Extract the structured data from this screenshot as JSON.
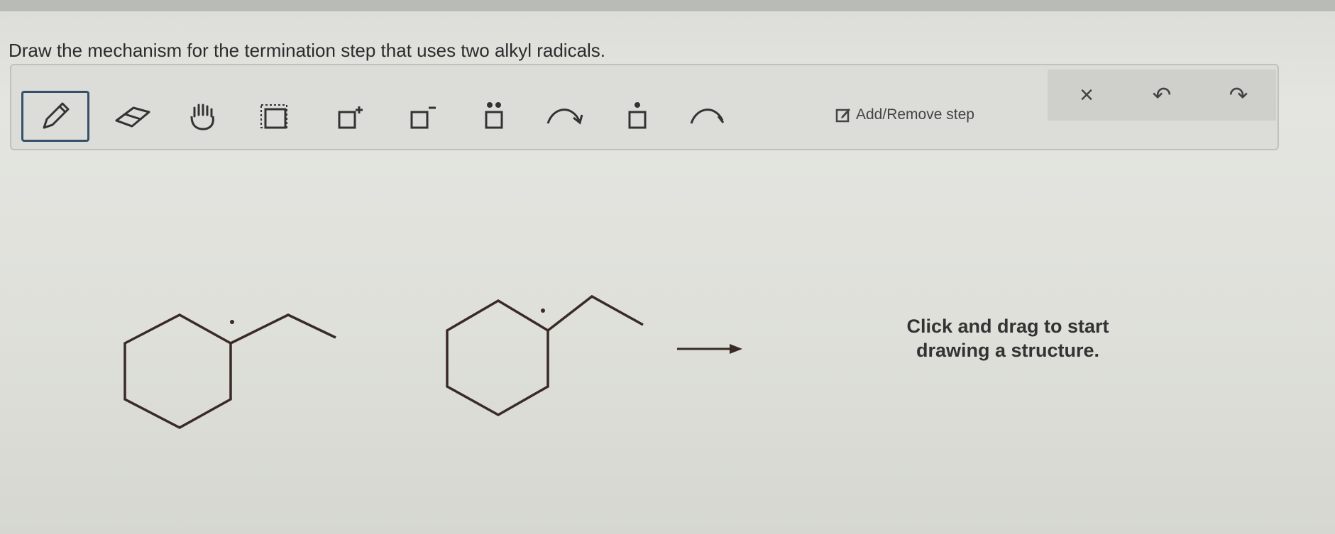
{
  "question": "Draw the mechanism for the termination step that uses two alkyl radicals.",
  "toolbar": {
    "tools": [
      {
        "name": "pencil-icon",
        "active": true
      },
      {
        "name": "eraser-icon"
      },
      {
        "name": "hand-icon"
      },
      {
        "name": "select-box-icon"
      },
      {
        "name": "positive-charge-icon"
      },
      {
        "name": "negative-charge-icon"
      },
      {
        "name": "lone-pair-icon"
      },
      {
        "name": "curved-arrow-icon"
      },
      {
        "name": "radical-electron-icon"
      },
      {
        "name": "single-electron-arrow-icon"
      }
    ],
    "add_remove_label": "Add/Remove step",
    "actions": [
      {
        "name": "clear-icon",
        "glyph": "×"
      },
      {
        "name": "undo-icon",
        "glyph": "↶"
      },
      {
        "name": "redo-icon",
        "glyph": "↷"
      }
    ]
  },
  "canvas": {
    "hint_line1": "Click and drag to start",
    "hint_line2": "drawing a structure."
  },
  "colors": {
    "active_border": "#35506b",
    "bond": "#3a2a26"
  }
}
